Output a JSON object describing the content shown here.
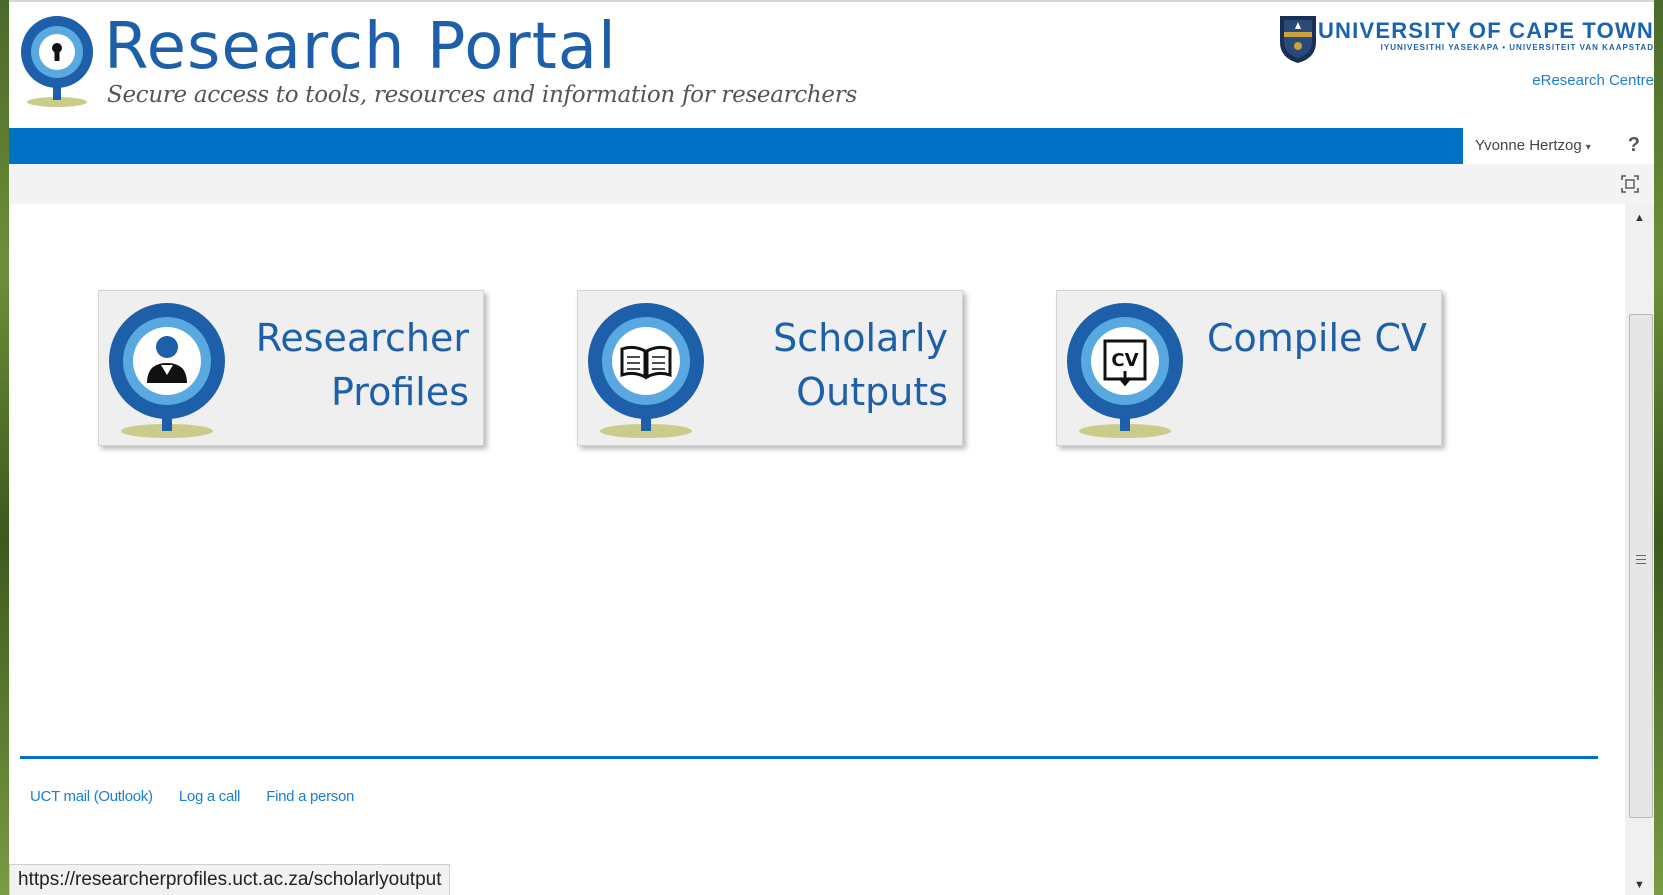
{
  "header": {
    "title": "Research Portal",
    "tagline": "Secure access to tools, resources and information for researchers",
    "university_name": "UNIVERSITY OF CAPE TOWN",
    "university_subtitle": "IYUNIVESITHI YASEKAPA • UNIVERSITEIT VAN KAAPSTAD",
    "ereasearch_link": "eResearch Centre"
  },
  "topbar": {
    "user_name": "Yvonne Hertzog",
    "help": "?"
  },
  "tiles": [
    {
      "line1": "Researcher",
      "line2": "Profiles",
      "icon": "person-icon"
    },
    {
      "line1": "Scholarly",
      "line2": "Outputs",
      "icon": "book-icon"
    },
    {
      "line1": "Compile CV",
      "line2": "",
      "icon": "cv-download-icon"
    }
  ],
  "footer": {
    "links": [
      "UCT mail (Outlook)",
      "Log a call",
      "Find a person"
    ]
  },
  "status_bar": {
    "url": "https://researcherprofiles.uct.ac.za/scholarlyoutput"
  },
  "colors": {
    "brand_blue": "#0072c6",
    "title_blue": "#1d5fa8",
    "link_blue": "#1a7fd3",
    "tile_bg": "#efefef"
  }
}
